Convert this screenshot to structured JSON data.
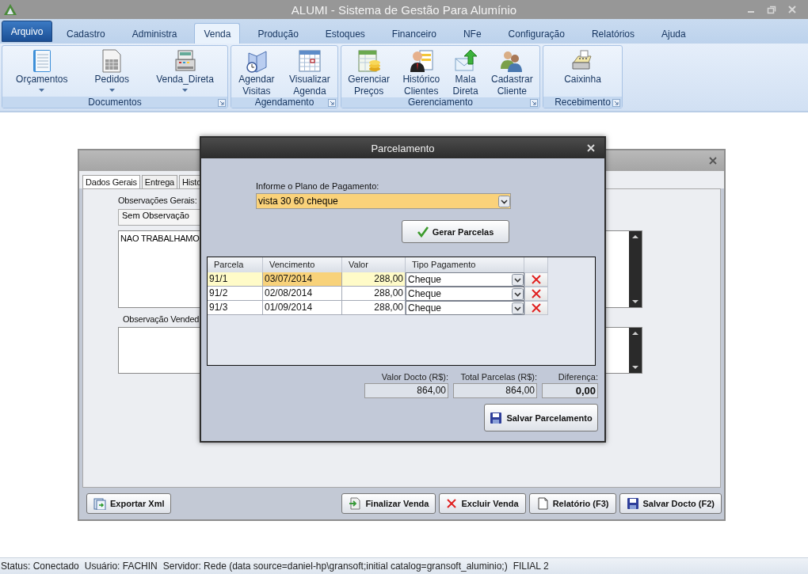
{
  "window": {
    "title": "ALUMI - Sistema de Gestão Para Alumínio"
  },
  "menu_tabs": [
    {
      "label": "Arquivo",
      "kind": "app",
      "selected": false
    },
    {
      "label": "Cadastro",
      "kind": "tab",
      "selected": false
    },
    {
      "label": "Administra",
      "kind": "tab",
      "selected": false
    },
    {
      "label": "Venda",
      "kind": "tab",
      "selected": true
    },
    {
      "label": "Produção",
      "kind": "tab",
      "selected": false
    },
    {
      "label": "Estoques",
      "kind": "tab",
      "selected": false
    },
    {
      "label": "Financeiro",
      "kind": "tab",
      "selected": false
    },
    {
      "label": "NFe",
      "kind": "tab",
      "selected": false
    },
    {
      "label": "Configuração",
      "kind": "tab",
      "selected": false
    },
    {
      "label": "Relatórios",
      "kind": "tab",
      "selected": false
    },
    {
      "label": "Ajuda",
      "kind": "tab",
      "selected": false
    }
  ],
  "ribbon_groups": [
    {
      "label": "Documentos",
      "buttons": [
        {
          "label": "Orçamentos",
          "dropdown": true
        },
        {
          "label": "Pedidos",
          "dropdown": true
        },
        {
          "label": "Venda_Direta",
          "dropdown": true
        }
      ]
    },
    {
      "label": "Agendamento",
      "buttons": [
        {
          "label": "Agendar Visitas",
          "dropdown": false
        },
        {
          "label": "Visualizar Agenda",
          "dropdown": false
        }
      ]
    },
    {
      "label": "Gerenciamento",
      "buttons": [
        {
          "label": "Gerenciar Preços",
          "dropdown": false
        },
        {
          "label": "Histórico Clientes",
          "dropdown": false
        },
        {
          "label": "Mala Direta",
          "dropdown": false
        },
        {
          "label": "Cadastrar Cliente",
          "dropdown": false
        }
      ]
    },
    {
      "label": "Recebimento",
      "buttons": [
        {
          "label": "Caixinha",
          "dropdown": false
        }
      ]
    }
  ],
  "background_window": {
    "tabs": [
      {
        "label": "Dados Gerais",
        "selected": true
      },
      {
        "label": "Entrega",
        "selected": false
      },
      {
        "label": "Histo",
        "selected": false
      }
    ],
    "general_notes_label": "Observações Gerais:",
    "notes_select": "Sem Observação",
    "general_notes": "NAO TRABALHAMO",
    "seller_notes_label": "Observação Vended",
    "left_buttons": [
      "Exportar Xml"
    ],
    "right_buttons": [
      "Finalizar Venda",
      "Excluir Venda",
      "Relatório (F3)",
      "Salvar Docto (F2)"
    ]
  },
  "dialog": {
    "title": "Parcelamento",
    "plan_label": "Informe o Plano de Pagamento:",
    "plan_value": "vista 30 60 cheque",
    "generate_button": "Gerar Parcelas",
    "table": {
      "columns": [
        "Parcela",
        "Vencimento",
        "Valor",
        "Tipo Pagamento"
      ],
      "rows": [
        {
          "installment": "91/1",
          "due_date": "03/07/2014",
          "amount": "288,00",
          "payment_type": "Cheque",
          "selected": true
        },
        {
          "installment": "91/2",
          "due_date": "02/08/2014",
          "amount": "288,00",
          "payment_type": "Cheque",
          "selected": false
        },
        {
          "installment": "91/3",
          "due_date": "01/09/2014",
          "amount": "288,00",
          "payment_type": "Cheque",
          "selected": false
        }
      ]
    },
    "totals": [
      {
        "label": "Valor Docto (R$):",
        "value": "864,00",
        "emphasized": false
      },
      {
        "label": "Total Parcelas (R$):",
        "value": "864,00",
        "emphasized": false
      },
      {
        "label": "Diferença:",
        "value": "0,00",
        "emphasized": true
      }
    ],
    "save_button": "Salvar Parcelamento"
  },
  "status_bar": [
    "Status: Conectado",
    "Usuário: FACHIN",
    "Servidor: Rede (data source=daniel-hp\\gransoft;initial catalog=gransoft_aluminio;)",
    "FILIAL 2"
  ]
}
